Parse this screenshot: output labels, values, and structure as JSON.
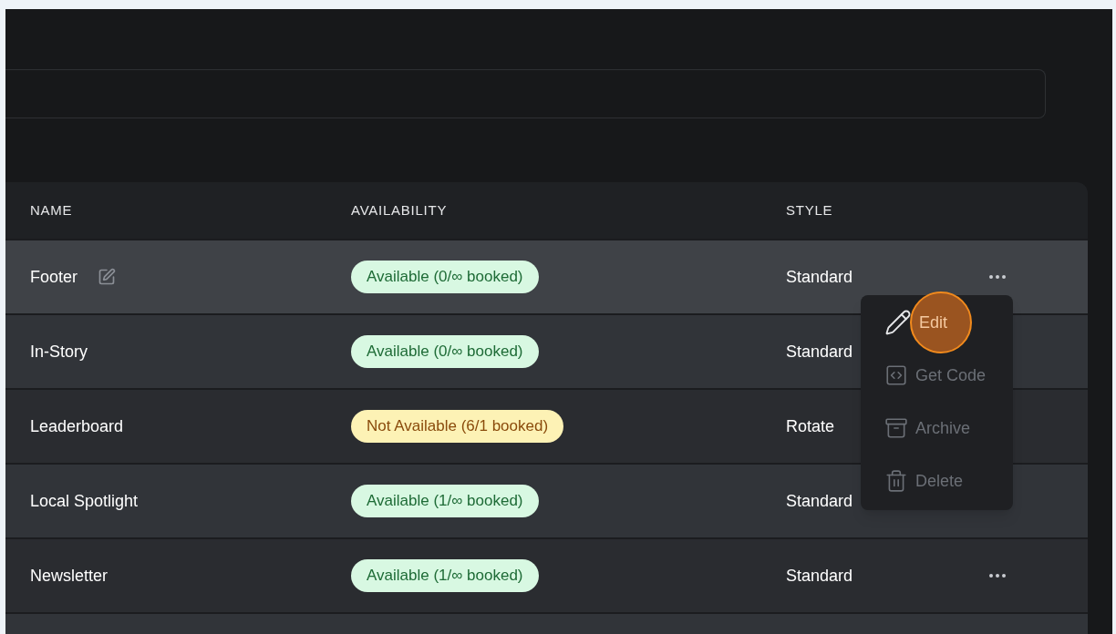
{
  "table": {
    "columns": [
      "NAME",
      "AVAILABILITY",
      "STYLE"
    ],
    "rows": [
      {
        "name": "Footer",
        "availability": "Available (0/∞ booked)",
        "kind": "available",
        "style": "Standard",
        "hovered": true,
        "more_icon": true
      },
      {
        "name": "In-Story",
        "availability": "Available (0/∞ booked)",
        "kind": "available",
        "style": "Standard",
        "hovered": false,
        "more_icon": false
      },
      {
        "name": "Leaderboard",
        "availability": "Not Available (6/1 booked)",
        "kind": "unavailable",
        "style": "Rotate",
        "hovered": false,
        "more_icon": false
      },
      {
        "name": "Local Spotlight",
        "availability": "Available (1/∞ booked)",
        "kind": "available",
        "style": "Standard",
        "hovered": false,
        "more_icon": false
      },
      {
        "name": "Newsletter",
        "availability": "Available (1/∞ booked)",
        "kind": "available",
        "style": "Standard",
        "hovered": false,
        "more_icon": true
      }
    ]
  },
  "menu": {
    "items": [
      {
        "kind": "edit",
        "label": "Edit",
        "highlighted": true
      },
      {
        "kind": "code",
        "label": "Get Code",
        "highlighted": false
      },
      {
        "kind": "archive",
        "label": "Archive",
        "highlighted": false
      },
      {
        "kind": "delete",
        "label": "Delete",
        "highlighted": false
      }
    ]
  }
}
